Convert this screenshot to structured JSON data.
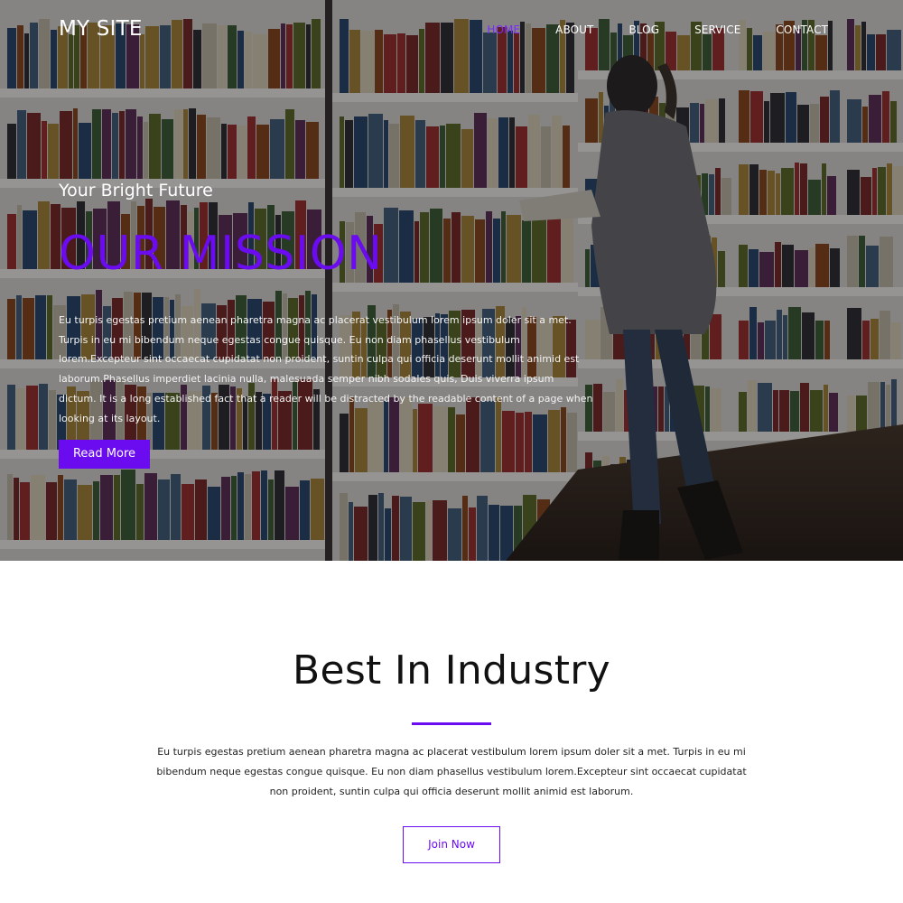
{
  "site": {
    "logo": "MY SITE"
  },
  "nav": {
    "items": [
      {
        "label": "HOME",
        "active": true
      },
      {
        "label": "ABOUT",
        "active": false
      },
      {
        "label": "BLOG",
        "active": false
      },
      {
        "label": "SERVICE",
        "active": false
      },
      {
        "label": "CONTACT",
        "active": false
      }
    ]
  },
  "hero": {
    "subtitle": "Your Bright Future",
    "title": "OUR MISSION",
    "text": "Eu turpis egestas pretium aenean pharetra magna ac placerat vestibulum lorem ipsum doler sit a met. Turpis in eu mi bibendum neque egestas congue quisque. Eu non diam phasellus vestibulum lorem.Excepteur sint occaecat cupidatat non proident, suntin culpa qui officia deserunt mollit animid est laborum.Phasellus imperdiet lacinia nulla, malesuada semper nibh sodales quis, Duis viverra ipsum dictum. It is a long established fact that a reader will be distracted by the readable content of a page when looking at its layout.",
    "button_label": "Read More",
    "background_icon": "bookstore-photo"
  },
  "industry": {
    "title": "Best In Industry",
    "text": "Eu turpis egestas pretium aenean pharetra magna ac placerat vestibulum lorem ipsum doler sit a met. Turpis in eu mi bibendum neque egestas congue quisque. Eu non diam phasellus vestibulum lorem.Excepteur sint occaecat cupidatat non proident, suntin culpa qui officia deserunt mollit animid est laborum.",
    "button_label": "Join Now"
  },
  "colors": {
    "accent": "#6a0bf0",
    "hero_overlay": "#1d1a1c",
    "text_dark": "#111111"
  }
}
